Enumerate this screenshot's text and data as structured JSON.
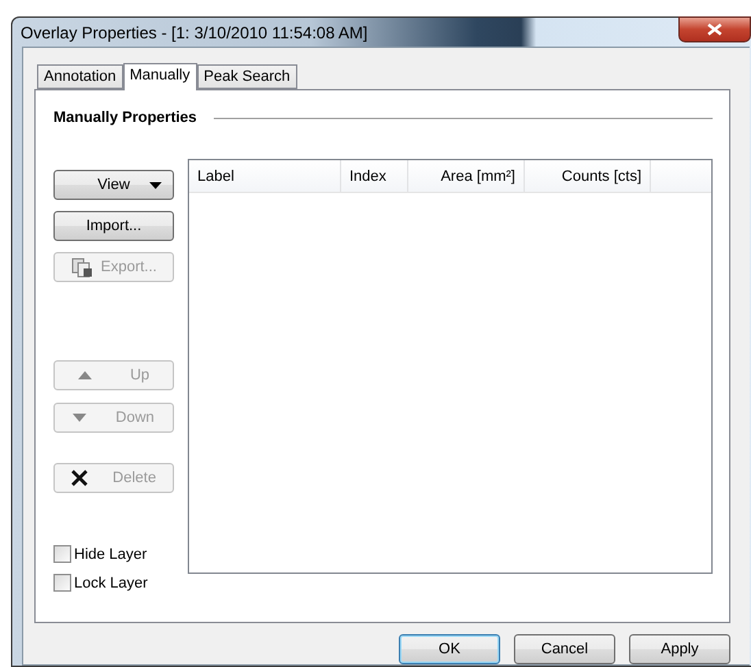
{
  "window": {
    "title": "Overlay Properties - [1: 3/10/2010 11:54:08 AM]"
  },
  "tabs": [
    {
      "label": "Annotation",
      "selected": false
    },
    {
      "label": "Manually",
      "selected": true
    },
    {
      "label": "Peak Search",
      "selected": false
    }
  ],
  "group": {
    "title": "Manually Properties"
  },
  "side_buttons": [
    {
      "label": "View",
      "kind": "dropdown",
      "disabled": false
    },
    {
      "label": "Import...",
      "kind": "plain",
      "disabled": false
    },
    {
      "label": "Export...",
      "kind": "export",
      "disabled": true
    },
    {
      "label": "Up",
      "kind": "up",
      "disabled": true
    },
    {
      "label": "Down",
      "kind": "down",
      "disabled": true
    },
    {
      "label": "Delete",
      "kind": "delete",
      "disabled": true
    }
  ],
  "checkboxes": [
    {
      "label": "Hide Layer",
      "checked": false
    },
    {
      "label": "Lock Layer",
      "checked": false
    }
  ],
  "table": {
    "columns": [
      {
        "label": "Label"
      },
      {
        "label": "Index"
      },
      {
        "label": "Area [mm²]"
      },
      {
        "label": "Counts [cts]"
      }
    ]
  },
  "buttons": [
    {
      "label": "OK",
      "default": true
    },
    {
      "label": "Cancel",
      "default": false
    },
    {
      "label": "Apply",
      "default": false
    }
  ]
}
